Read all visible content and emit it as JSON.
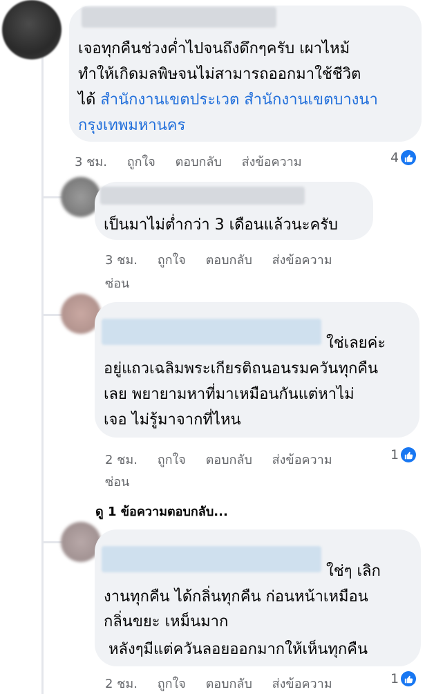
{
  "comments": [
    {
      "lines": [
        "เจอทุกคืนช่วงค่ำไปจนถึงดึกๆครับ เผาไหม้",
        "ทำให้เกิดมลพิษจนไม่สามารถออกมาใช้ชีวิต",
        "ได้ "
      ],
      "tags": [
        "สำนักงานเขตประเวต สำนักงานเขตบางนา",
        "กรุงเทพมหานคร"
      ],
      "time": "3 ชม.",
      "like": "ถูกใจ",
      "reply": "ตอบกลับ",
      "message": "ส่งข้อความ",
      "reactions": "4"
    },
    {
      "lines": [
        "เป็นมาไม่ต่ำกว่า 3 เดือนแล้วนะครับ"
      ],
      "time": "3 ชม.",
      "like": "ถูกใจ",
      "reply": "ตอบกลับ",
      "message": "ส่งข้อความ",
      "hide": "ซ่อน"
    },
    {
      "lines": [
        "ใช่เลยค่ะ",
        "อยู่แถวเฉลิมพระเกียรติถนอนรมควันทุกคืน",
        "เลย พยายามหาที่มาเหมือนกันแต่หาไม่",
        "เจอ ไม่รู้มาจากที่ไหน"
      ],
      "time": "2 ชม.",
      "like": "ถูกใจ",
      "reply": "ตอบกลับ",
      "message": "ส่งข้อความ",
      "hide": "ซ่อน",
      "reactions": "1"
    },
    {
      "lines": [
        "ใช่ๆ เลิก",
        "งานทุกคืน ได้กลิ่นทุกคืน ก่อนหน้าเหมือน",
        "กลิ่นขยะ เหม็นมาก",
        "หลังๆมีแต่ควันลอยออกมากให้เห็นทุกคืน"
      ],
      "time": "2 ชม.",
      "like": "ถูกใจ",
      "reply": "ตอบกลับ",
      "message": "ส่งข้อความ",
      "reactions": "1"
    }
  ],
  "view_replies": "ดู 1 ข้อความตอบกลับ...",
  "colors": {
    "link": "#216fdb",
    "like_badge": "#1877f2",
    "bubble": "#f0f2f5"
  }
}
